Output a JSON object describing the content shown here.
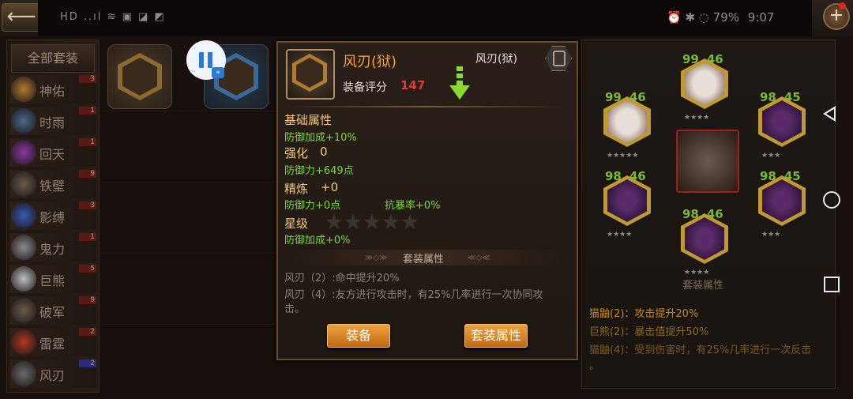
{
  "status_bar": {
    "left_icons": "HD ..ıl ≋ ▣ ◪ ◩",
    "battery": "79%",
    "time": "9:07",
    "right_icons": "⏰ ✱ ◌"
  },
  "sidebar": {
    "all_label": "全部套装",
    "items": [
      {
        "label": "神佑",
        "count": "3"
      },
      {
        "label": "时雨",
        "count": "1"
      },
      {
        "label": "回天",
        "count": "1"
      },
      {
        "label": "铁壁",
        "count": "9"
      },
      {
        "label": "影缚",
        "count": "3"
      },
      {
        "label": "鬼力",
        "count": "1"
      },
      {
        "label": "巨熊",
        "count": "5"
      },
      {
        "label": "破军",
        "count": "9"
      },
      {
        "label": "雷霆",
        "count": "2"
      },
      {
        "label": "风刃",
        "count": "2"
      }
    ]
  },
  "popup": {
    "item_name": "风刃(狱)",
    "item_name_right": "风刃(狱)",
    "score_label": "装备评分",
    "score_value": "147",
    "base_title": "基础属性",
    "base_stat": "防御加成+10%",
    "strengthen_label": "强化",
    "strengthen_value": "0",
    "strengthen_stat": "防御力+649点",
    "refine_label": "精炼",
    "refine_value": "+0",
    "refine_stat1": "防御力+0点",
    "refine_stat2": "抗暴率+0%",
    "star_label": "星级",
    "star_stat": "防御加成+0%",
    "set_band_label": "套装属性",
    "set_line1": "风刃（2）:命中提升20%",
    "set_line2a": "风刃（4）:友方进行攻击时，有25%几率进行一次协同攻",
    "set_line2b": "击。",
    "equip_button": "装备",
    "set_button": "套装属性"
  },
  "right_panel": {
    "masks": [
      {
        "level": "99",
        "sub": "46",
        "stars": "★★★★"
      },
      {
        "level": "99",
        "sub": "46",
        "stars": "★★★★★"
      },
      {
        "level": "98",
        "sub": "45",
        "stars": "★★★"
      },
      {
        "level": "98",
        "sub": "46",
        "stars": "★★★★"
      },
      {
        "level": "98",
        "sub": "45",
        "stars": "★★★"
      },
      {
        "level": "98",
        "sub": "46",
        "stars": "★★★★"
      }
    ],
    "set_label": "套装属性",
    "lines": [
      "猫鼬(2)：攻击提升20%",
      "巨熊(2)：暴击值提升50%",
      "猫鼬(4)：受到伤害时，有25%几率进行一次反击",
      "。"
    ]
  },
  "colors": {
    "accent": "#f0a040",
    "green": "#7ad838",
    "score_red": "#e03838"
  }
}
